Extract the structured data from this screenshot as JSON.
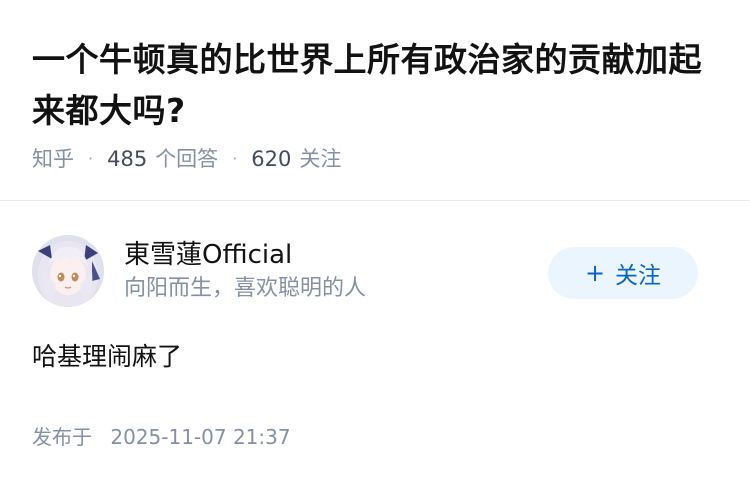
{
  "question": {
    "title": "一个牛顿真的比世界上所有政治家的贡献加起来都大吗?",
    "source": "知乎",
    "answer_count": "485",
    "answer_label": "个回答",
    "follower_count": "620",
    "follower_label": "关注"
  },
  "answer": {
    "author": {
      "name": "東雪蓮Official",
      "bio": "向阳而生，喜欢聪明的人",
      "avatar_icon": "anime-girl-avatar"
    },
    "follow_button": {
      "icon": "plus-icon",
      "plus": "+",
      "label": "关注"
    },
    "content": "哈基理闹麻了",
    "published_label": "发布于",
    "published_date": "2025-11-07 21:37"
  },
  "colors": {
    "primary_text": "#121212",
    "secondary_text": "#8590a6",
    "follow_bg": "#ebf5fd",
    "follow_text": "#0a66c2",
    "divider": "#ebebeb"
  }
}
